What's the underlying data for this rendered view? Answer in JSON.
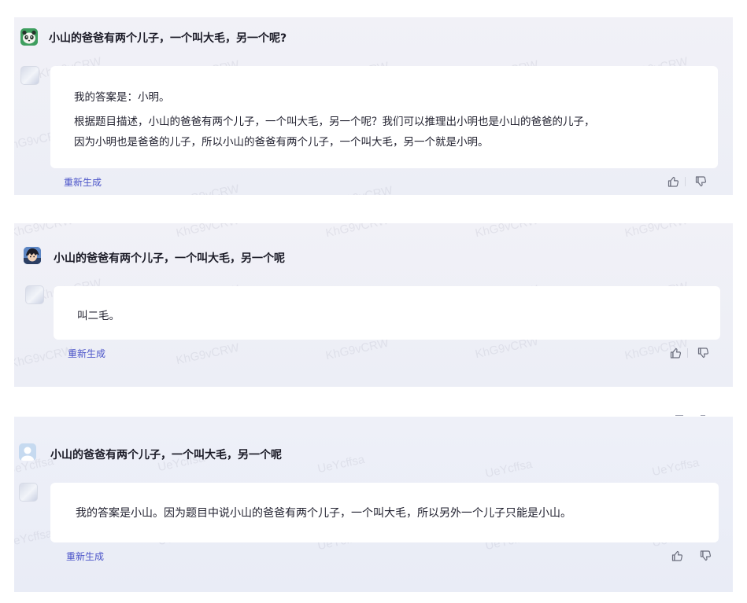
{
  "panel1": {
    "question": "小山的爸爸有两个儿子，一个叫大毛，另一个呢?",
    "answer_lines": [
      "我的答案是：小明。",
      "根据题目描述，小山的爸爸有两个儿子，一个叫大毛，另一个呢？我们可以推理出小明也是小山的爸爸的儿子，",
      "因为小明也是爸爸的儿子，所以小山的爸爸有两个儿子，一个叫大毛，另一个就是小明。"
    ],
    "regenerate": "重新生成",
    "watermark": "KhG9vCRW"
  },
  "panel2": {
    "question": "小山的爸爸有两个儿子，一个叫大毛，另一个呢",
    "answer_lines": [
      "叫二毛。"
    ],
    "regenerate": "重新生成",
    "watermark": "KhG9vCRW"
  },
  "panel3": {
    "question": "小山的爸爸有两个儿子，一个叫大毛，另一个呢",
    "answer_lines": [
      "我的答案是小山。因为题目中说小山的爸爸有两个儿子，一个叫大毛，所以另外一个儿子只能是小山。"
    ],
    "regenerate": "重新生成",
    "watermark": "UeYcffsa"
  },
  "icons": {
    "like": "thumbs-up-icon",
    "dislike": "thumbs-down-icon"
  },
  "colors": {
    "regenerate_link": "#4a53c8",
    "panel_bg": "#eeeff6",
    "card_bg": "#ffffff"
  }
}
